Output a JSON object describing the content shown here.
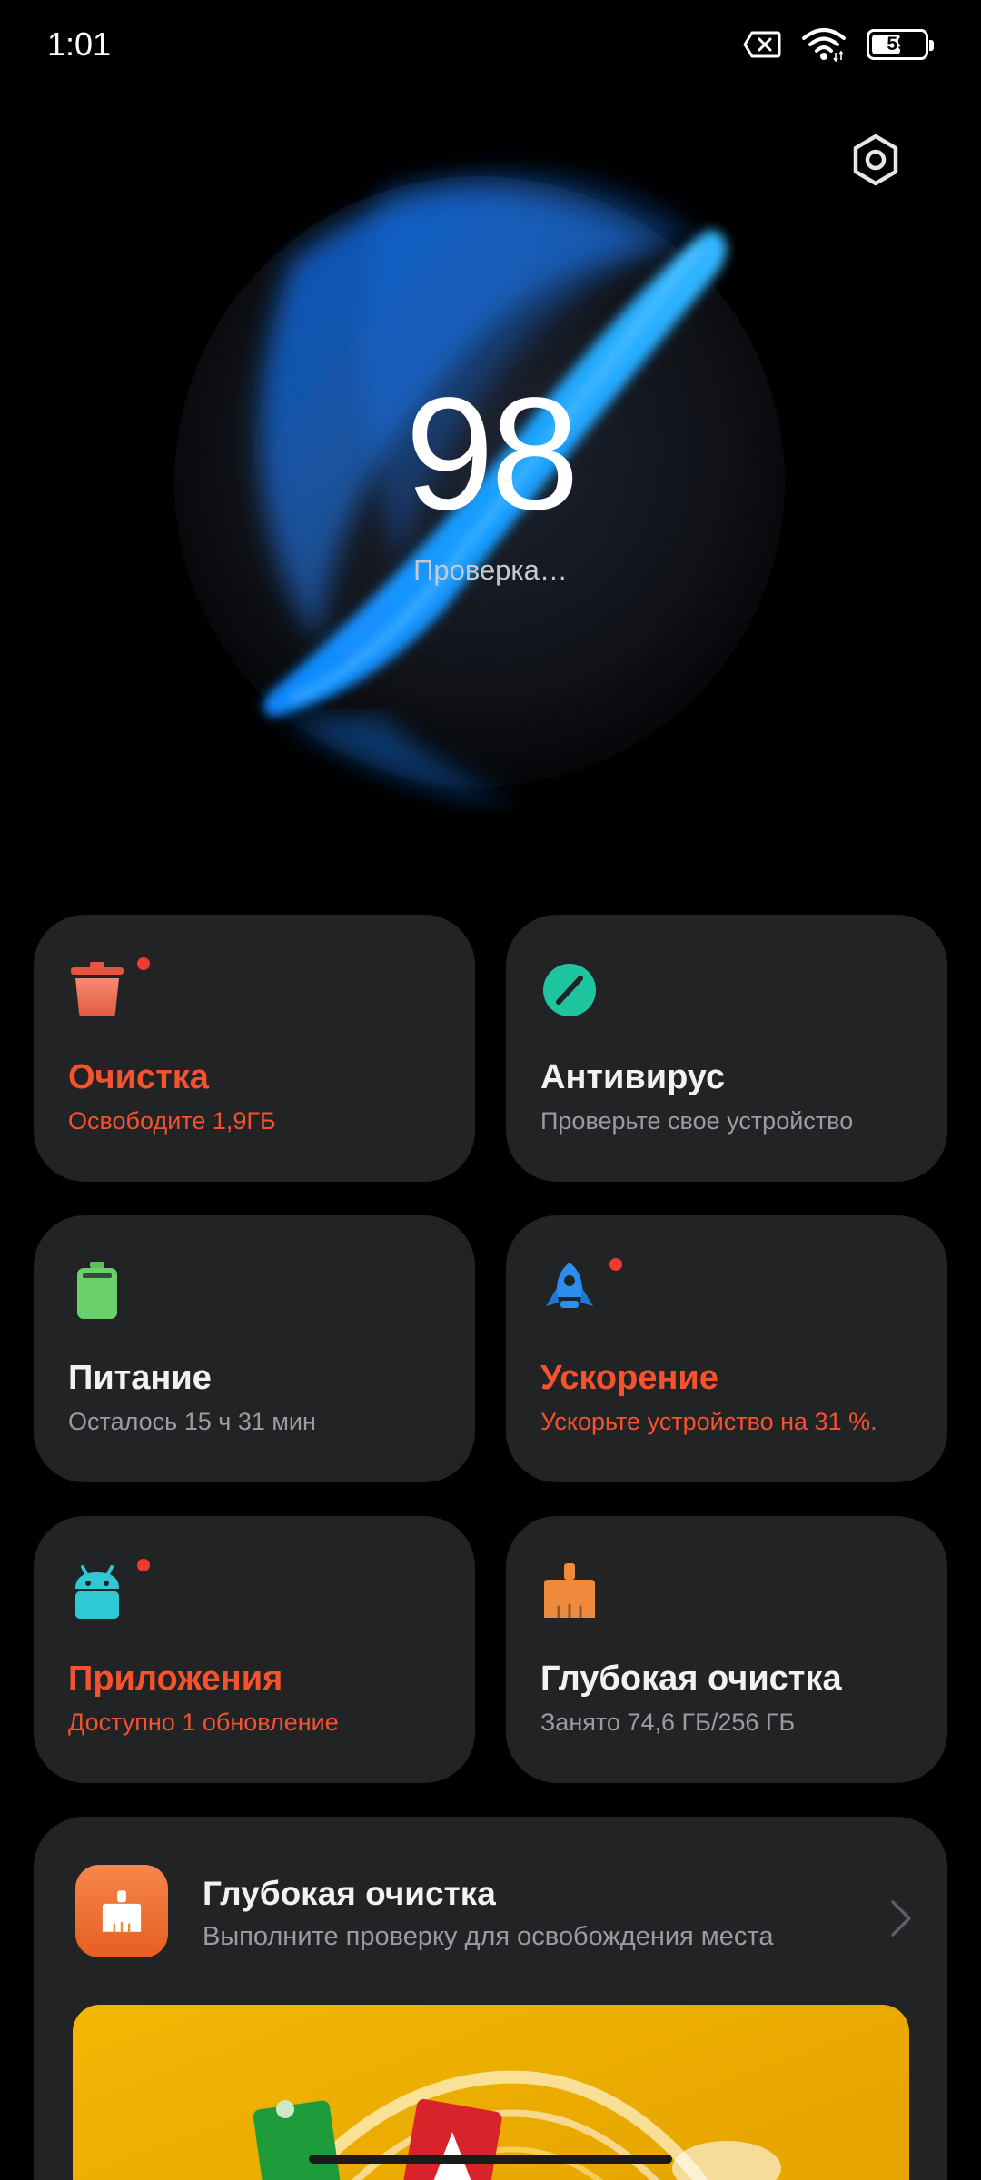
{
  "status_bar": {
    "time": "1:01",
    "battery_level": "59",
    "icons": [
      "sim-off-icon",
      "wifi-icon",
      "battery-icon"
    ]
  },
  "header": {
    "settings_icon": "settings-gear-icon"
  },
  "score": {
    "value": "98",
    "label": "Проверка…"
  },
  "tiles": [
    {
      "title": "Очистка",
      "subtitle": "Освободите 1,9ГБ",
      "icon": "trash-icon",
      "alert": true,
      "accent": "#f5522d"
    },
    {
      "title": "Антивирус",
      "subtitle": "Проверьте свое устройство",
      "icon": "antivirus-icon",
      "alert": false,
      "accent": "#1ec6a0"
    },
    {
      "title": "Питание",
      "subtitle": "Осталось 15 ч 31 мин",
      "icon": "battery-icon",
      "alert": false,
      "accent": "#66cc66"
    },
    {
      "title": "Ускорение",
      "subtitle": "Ускорьте устройство на 31 %.",
      "icon": "rocket-icon",
      "alert": true,
      "accent": "#2c8ff0"
    },
    {
      "title": "Приложения",
      "subtitle": "Доступно 1 обновление",
      "icon": "android-icon",
      "alert": true,
      "accent": "#2fc9d6"
    },
    {
      "title": "Глубокая очистка",
      "subtitle": "Занято 74,6 ГБ/256 ГБ",
      "icon": "broom-icon",
      "alert": false,
      "accent": "#ef8a3c"
    }
  ],
  "deep_clean_card": {
    "title": "Глубокая очистка",
    "subtitle": "Выполните проверку для освобождения места",
    "icon": "broom-icon",
    "banner_color": "#f2b705"
  },
  "colors": {
    "background": "#000000",
    "tile_bg": "#222325",
    "alert_red": "#f5522d",
    "orb_blue": "#1a8cff"
  }
}
